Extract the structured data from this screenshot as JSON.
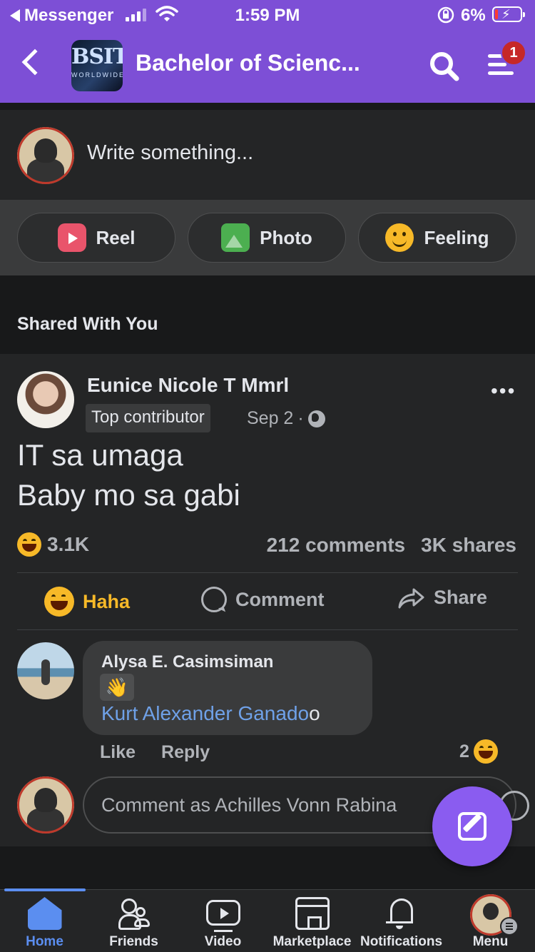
{
  "status_bar": {
    "back_app": "Messenger",
    "time": "1:59 PM",
    "battery": "6%"
  },
  "header": {
    "logo_text": "BSIT",
    "logo_subtext": "WORLDWIDE",
    "title": "Bachelor of Scienc...",
    "notification_count": "1"
  },
  "composer": {
    "prompt": "Write something..."
  },
  "actions": [
    {
      "label": "Reel",
      "icon": "reel-icon"
    },
    {
      "label": "Photo",
      "icon": "photo-icon"
    },
    {
      "label": "Feeling",
      "icon": "feeling-icon"
    }
  ],
  "section_title": "Shared With You",
  "post": {
    "author": "Eunice Nicole T Mmrl",
    "badge": "Top contributor",
    "date": "Sep 2",
    "date_separator": "·",
    "text_line1": "IT sa umaga",
    "text_line2": "Baby mo sa gabi",
    "reaction_count": "3.1K",
    "comments": "212 comments",
    "shares": "3K shares",
    "buttons": {
      "haha": "Haha",
      "comment": "Comment",
      "share": "Share"
    }
  },
  "comment": {
    "author": "Alysa E. Casimsiman",
    "mention": "Kurt Alexander Ganado",
    "trailing": "o",
    "like": "Like",
    "reply": "Reply",
    "reaction_count": "2"
  },
  "reply_input": {
    "placeholder": "Comment as Achilles Vonn Rabina"
  },
  "tabs": [
    {
      "label": "Home"
    },
    {
      "label": "Friends"
    },
    {
      "label": "Video"
    },
    {
      "label": "Marketplace"
    },
    {
      "label": "Notifications"
    },
    {
      "label": "Menu"
    }
  ],
  "colors": {
    "header_bg": "#7d4fd6",
    "accent_blue": "#5b8ef0",
    "haha_yellow": "#f7b928",
    "mention_blue": "#6fa1e8"
  }
}
